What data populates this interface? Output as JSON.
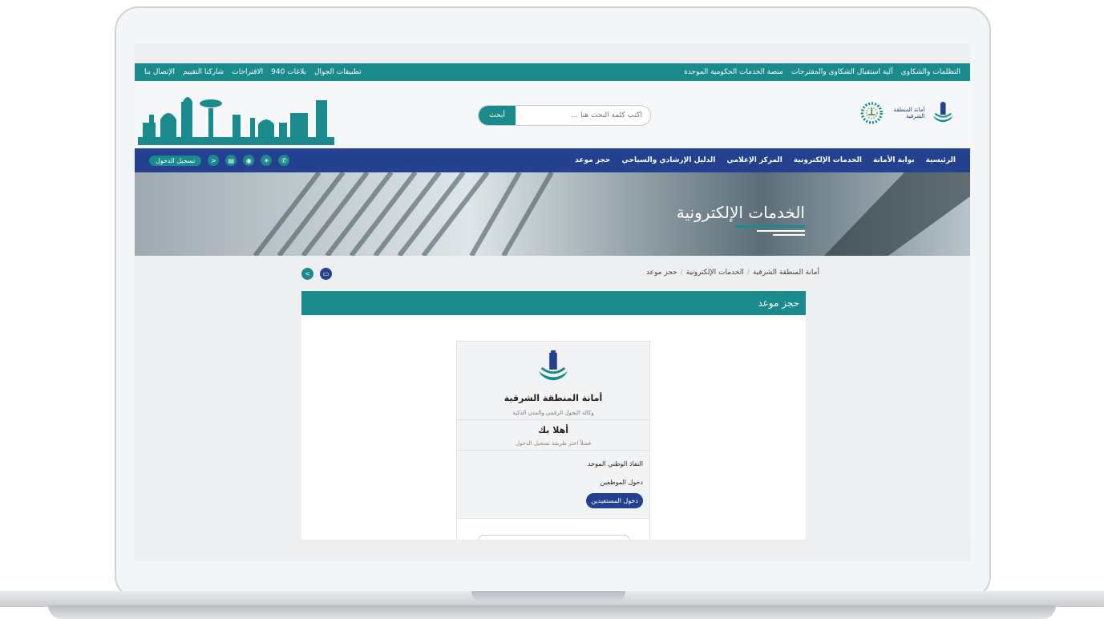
{
  "topbar": {
    "right_links": [
      "التظلمات والشكاوى",
      "آلية استقبال الشكاوى والمقترحات",
      "منصة الخدمات الحكومية الموحدة"
    ],
    "left_links": [
      "تطبيقات الجوال",
      "بلاغات 940",
      "الاقتراحات",
      "شاركنا التقييم",
      "الإتصال بنا"
    ]
  },
  "header": {
    "logo_text": "أمانة المنطقة الشرقية",
    "search_placeholder": "أكتب كلمة البحث هنا ...",
    "search_button": "أبحث"
  },
  "nav": {
    "items": [
      "الرئيسية",
      "بوابة الأمانة",
      "الخدمات الإلكترونية",
      "المركز الإعلامي",
      "الدليل الإرشادي والسياحي",
      "حجز موعد"
    ],
    "login": "تسجيل الدخول"
  },
  "banner": {
    "title": "الخدمات الإلكترونية"
  },
  "breadcrumb": [
    "أمانة المنطقة الشرقية",
    "الخدمات الإلكترونية",
    "حجز موعد"
  ],
  "section": {
    "title": "حجز موعد"
  },
  "card": {
    "org": "أمانة المنطقة الشرقية",
    "agency": "وكالة التحول الرقمي والمدن الذكية",
    "welcome": "أهلا بك",
    "hint": "فضلاً اختر طريقة تسجيل الدخول",
    "option1": "النفاذ الوطني الموحد",
    "option2": "دخول الموظفين",
    "option3": "دخول المستفيدين"
  },
  "colors": {
    "teal": "#1a8a8c",
    "navy": "#24418f"
  }
}
